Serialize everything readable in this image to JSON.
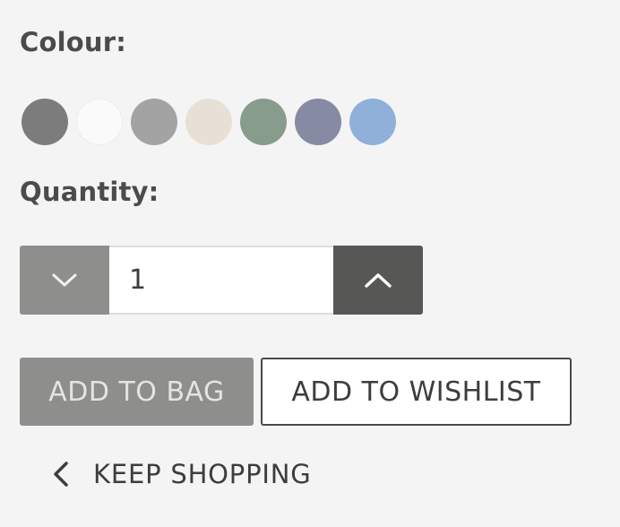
{
  "colour": {
    "label": "Colour:",
    "swatches": [
      {
        "name": "charcoal",
        "color": "#7c7c7c"
      },
      {
        "name": "white",
        "color": "#fafafa"
      },
      {
        "name": "grey",
        "color": "#a3a3a3"
      },
      {
        "name": "oatmeal",
        "color": "#e8e0d6"
      },
      {
        "name": "sage",
        "color": "#879c8c"
      },
      {
        "name": "slate-blue",
        "color": "#868aa2"
      },
      {
        "name": "sky-blue",
        "color": "#8fb0d9"
      }
    ]
  },
  "quantity": {
    "label": "Quantity:",
    "value": "1",
    "decrease_icon": "chevron-down-icon",
    "increase_icon": "chevron-up-icon"
  },
  "actions": {
    "add_to_bag": "ADD TO BAG",
    "add_to_wishlist": "ADD TO WISHLIST"
  },
  "keep_shopping": {
    "label": "KEEP SHOPPING",
    "icon": "chevron-left-icon"
  }
}
